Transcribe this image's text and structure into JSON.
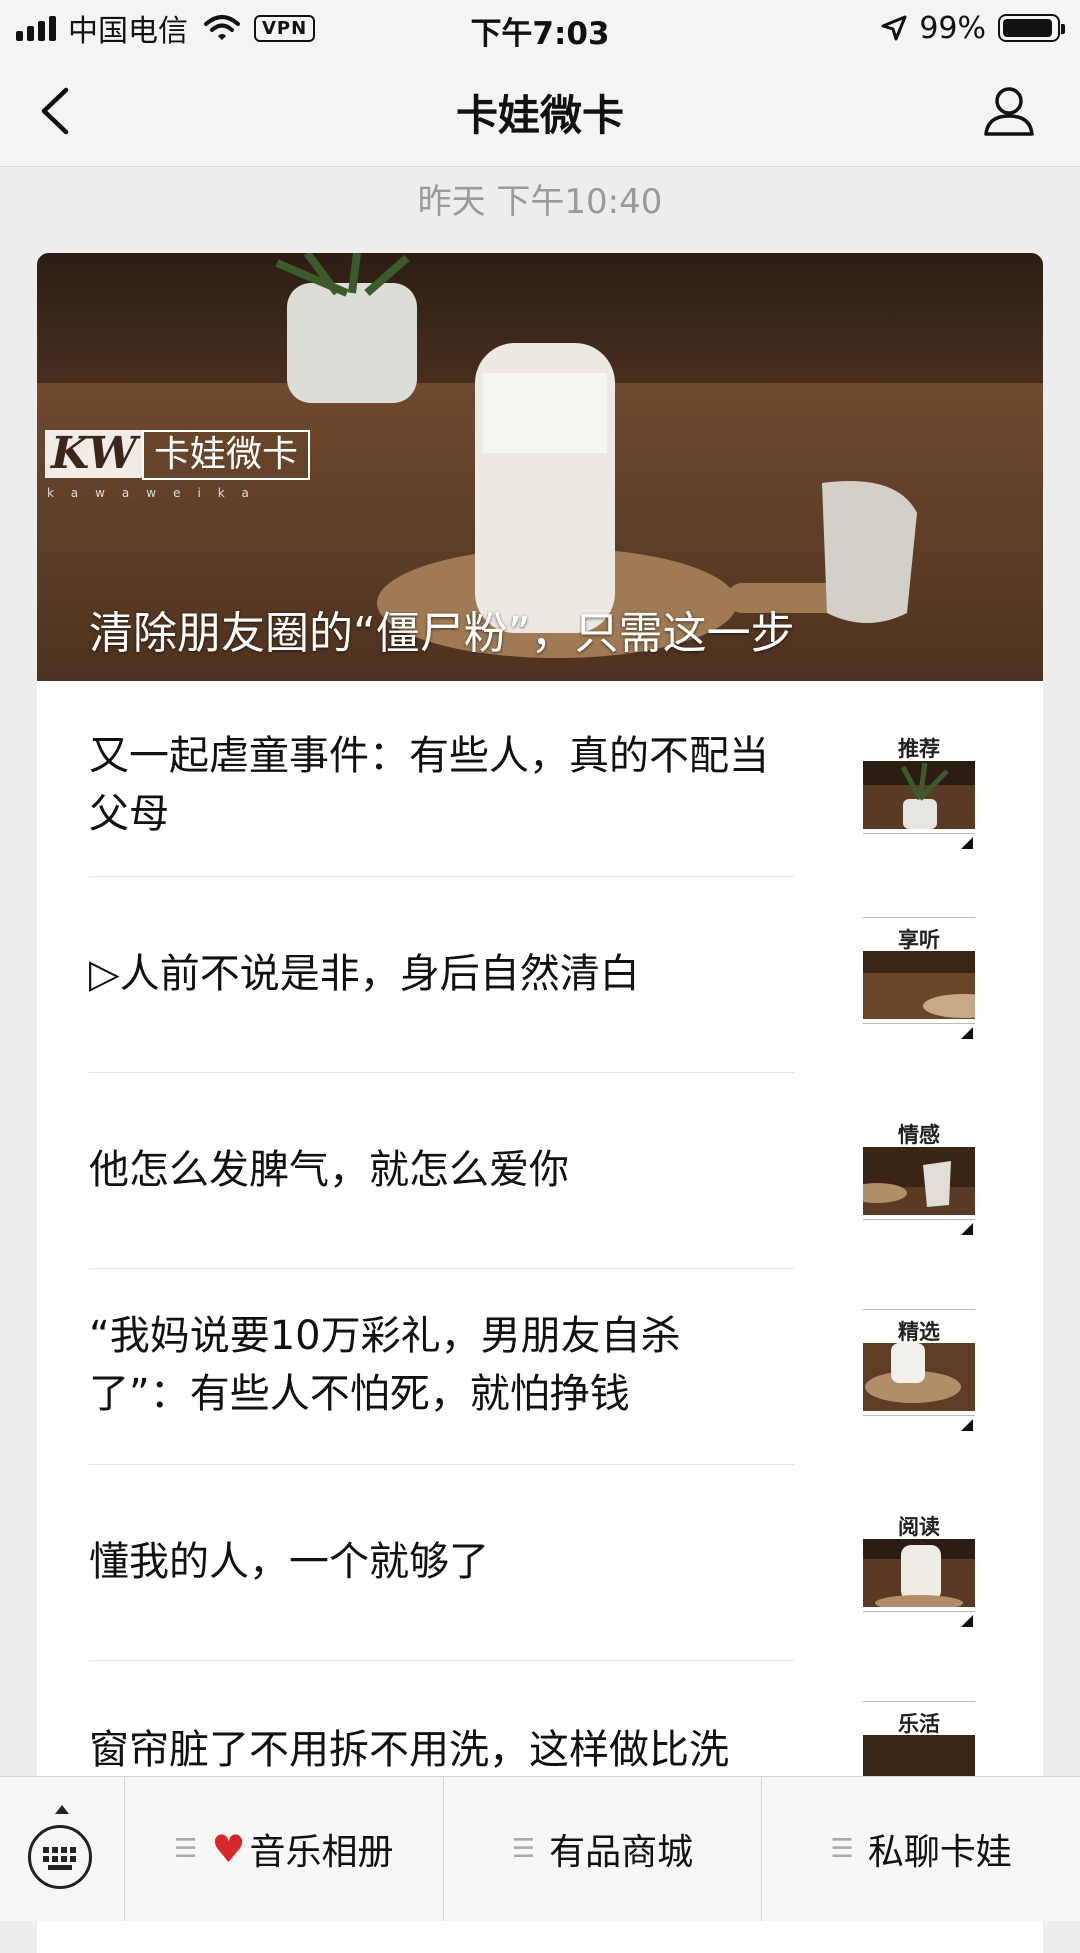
{
  "status_bar": {
    "carrier": "中国电信",
    "vpn_label": "VPN",
    "time": "下午7:03",
    "battery_percent": "99%",
    "icons": [
      "signal-icon",
      "wifi-icon",
      "location-arrow-icon",
      "battery-icon"
    ]
  },
  "nav": {
    "title": "卡娃微卡",
    "back_icon": "back-chevron-icon",
    "profile_icon": "profile-icon"
  },
  "timestamp": "昨天 下午10:40",
  "hero": {
    "title": "清除朋友圈的“僵尸粉”，只需这一步",
    "logo_mark": "KW",
    "logo_name": "卡娃微卡",
    "logo_sub": "kawaweika"
  },
  "articles": [
    {
      "title": "又一起虐童事件：有些人，真的不配当父母",
      "tag": "推荐"
    },
    {
      "title": "▷人前不说是非，身后自然清白",
      "tag": "享听"
    },
    {
      "title": "他怎么发脾气，就怎么爱你",
      "tag": "情感"
    },
    {
      "title": "“我妈说要10万彩礼，男朋友自杀了”：有些人不怕死，就怕挣钱",
      "tag": "精选"
    },
    {
      "title": "懂我的人，一个就够了",
      "tag": "阅读"
    },
    {
      "title": "窗帘脏了不用拆不用洗，这样做比洗",
      "tag": "乐活"
    }
  ],
  "bottom_menu": {
    "keyboard_icon": "keyboard-icon",
    "items": [
      {
        "label": "音乐相册",
        "icon": "heart-icon"
      },
      {
        "label": "有品商城"
      },
      {
        "label": "私聊卡娃"
      }
    ]
  },
  "colors": {
    "background": "#ededed",
    "card": "#ffffff",
    "heart": "#d9262c",
    "muted_text": "#9a9a9a"
  }
}
